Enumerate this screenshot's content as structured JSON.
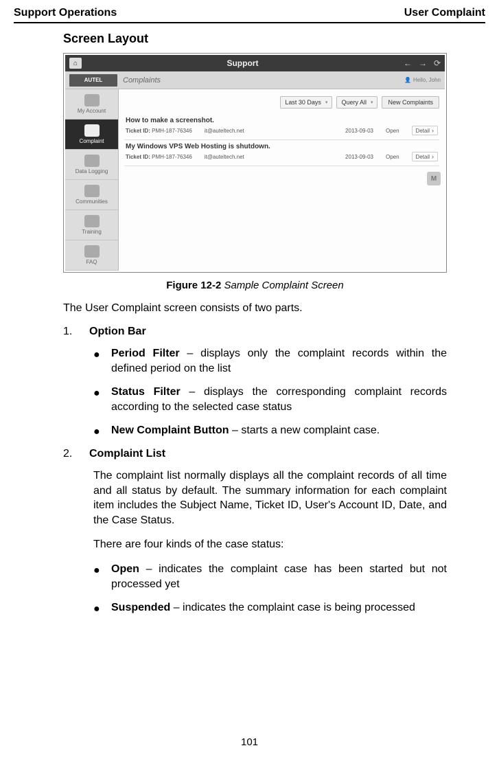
{
  "header": {
    "left": "Support Operations",
    "right": "User Complaint"
  },
  "section_title": "Screen Layout",
  "figure": {
    "topbar": {
      "title": "Support",
      "back": "←",
      "fwd": "→",
      "refresh": "⟳",
      "home": "⌂"
    },
    "row2": {
      "logo": "AUTEL",
      "crumb": "Complaints",
      "hello": "Hello, John"
    },
    "sidebar": {
      "items": [
        {
          "label": "My Account"
        },
        {
          "label": "Complaint"
        },
        {
          "label": "Data Logging"
        },
        {
          "label": "Communities"
        },
        {
          "label": "Training"
        },
        {
          "label": "FAQ"
        }
      ]
    },
    "optionbar": {
      "period": "Last 30 Days",
      "status": "Query All",
      "new_btn": "New Complaints"
    },
    "tickets": [
      {
        "subject": "How to make a screenshot.",
        "ticket_label": "Ticket ID:",
        "ticket_id": "PMH-187-76346",
        "email": "it@auteltech.net",
        "date": "2013-09-03",
        "status": "Open",
        "detail": "Detail"
      },
      {
        "subject": "My Windows VPS Web Hosting is shutdown.",
        "ticket_label": "Ticket ID:",
        "ticket_id": "PMH-187-76346",
        "email": "it@auteltech.net",
        "date": "2013-09-03",
        "status": "Open",
        "detail": "Detail"
      }
    ],
    "float_label": "M"
  },
  "caption": {
    "bold": "Figure 12-2",
    "italic": " Sample Complaint Screen"
  },
  "intro": "The User Complaint screen consists of two parts.",
  "list": {
    "item1_num": "1.",
    "item1_title": "Option Bar",
    "item1_bullets": [
      {
        "lead": "Period Filter",
        "rest": " – displays only the complaint records within the defined period on the list"
      },
      {
        "lead": "Status Filter",
        "rest": " – displays the corresponding complaint records according to the selected case status"
      },
      {
        "lead": "New Complaint Button",
        "rest": " – starts a new complaint case."
      }
    ],
    "item2_num": "2.",
    "item2_title": "Complaint List",
    "item2_para1": "The complaint list normally displays all the complaint records of all time and all status by default. The summary information for each complaint item includes the Subject Name, Ticket ID, User's Account ID, Date, and the Case Status.",
    "item2_para2": "There are four kinds of the case status:",
    "item2_bullets": [
      {
        "lead": "Open",
        "rest": " – indicates the complaint case has been started but not processed yet"
      },
      {
        "lead": "Suspended",
        "rest": " – indicates the complaint case is being processed"
      }
    ]
  },
  "page_number": "101"
}
